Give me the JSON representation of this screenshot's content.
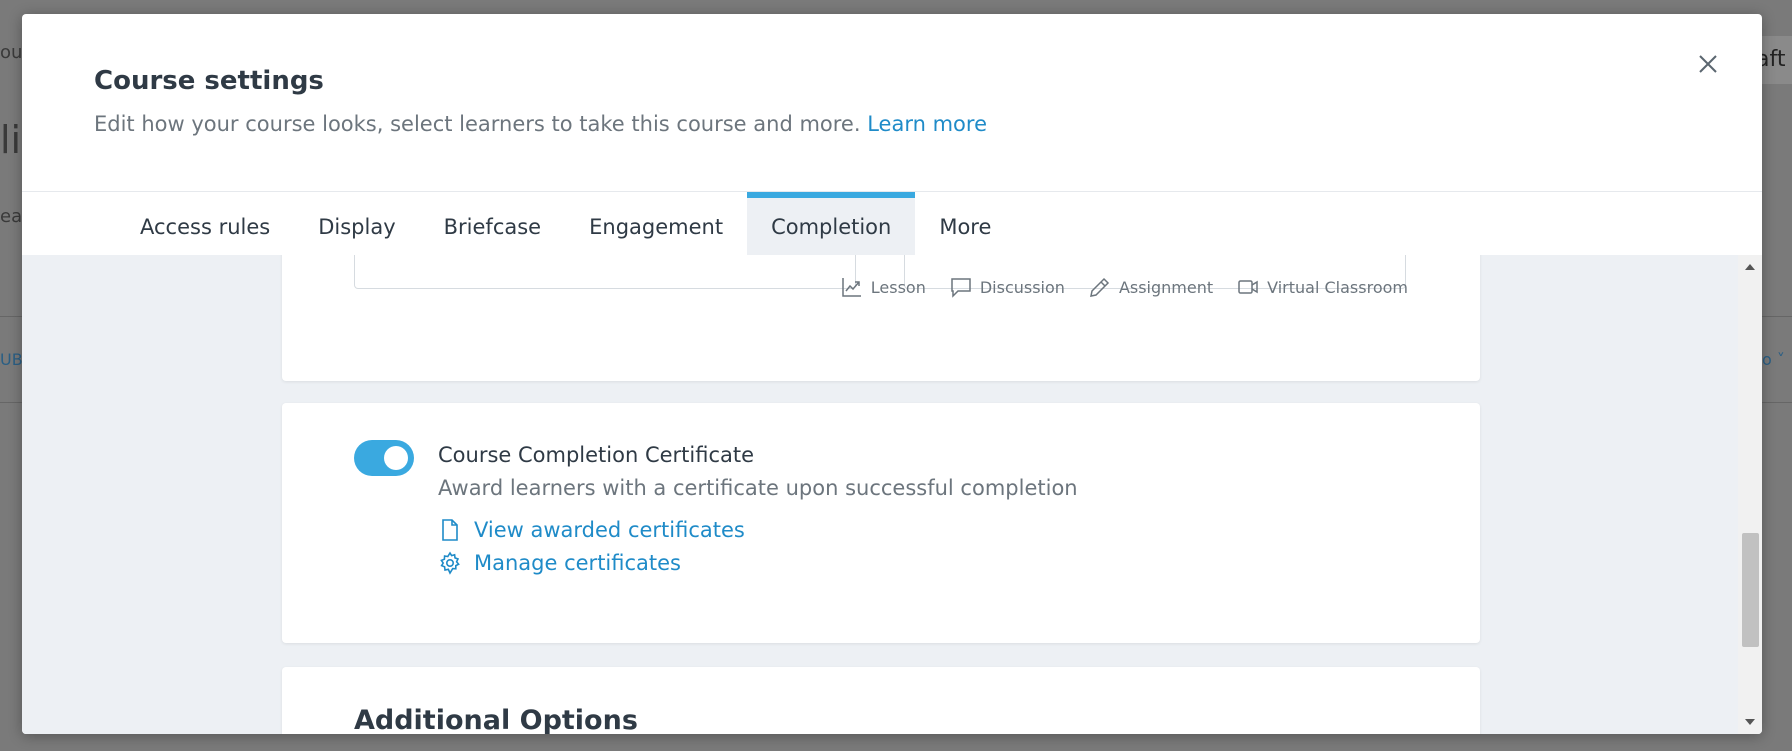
{
  "background": {
    "fragments": [
      "our",
      "li",
      "ea",
      "UB",
      "o ˅",
      "aft"
    ]
  },
  "modal": {
    "title": "Course settings",
    "subtitle": "Edit how your course looks, select learners to take this course and more.",
    "learn_more": "Learn more",
    "close_icon": "close-icon"
  },
  "tabs": [
    {
      "label": "Access rules",
      "active": false
    },
    {
      "label": "Display",
      "active": false
    },
    {
      "label": "Briefcase",
      "active": false
    },
    {
      "label": "Engagement",
      "active": false
    },
    {
      "label": "Completion",
      "active": true
    },
    {
      "label": "More",
      "active": false
    }
  ],
  "activities": [
    {
      "label": "Lesson",
      "icon": "chart-line-icon"
    },
    {
      "label": "Discussion",
      "icon": "speech-bubble-icon"
    },
    {
      "label": "Assignment",
      "icon": "pencil-icon"
    },
    {
      "label": "Virtual Classroom",
      "icon": "video-camera-icon"
    }
  ],
  "certificate": {
    "enabled": true,
    "title": "Course Completion Certificate",
    "description": "Award learners with a certificate upon successful completion",
    "view_link": "View awarded certificates",
    "manage_link": "Manage certificates"
  },
  "additional": {
    "title": "Additional Options"
  },
  "colors": {
    "accent": "#3aa9e0",
    "link": "#1f8bc8",
    "panel_bg": "#edf0f4",
    "text_dark": "#2f3a45",
    "text_muted": "#6c757d"
  }
}
